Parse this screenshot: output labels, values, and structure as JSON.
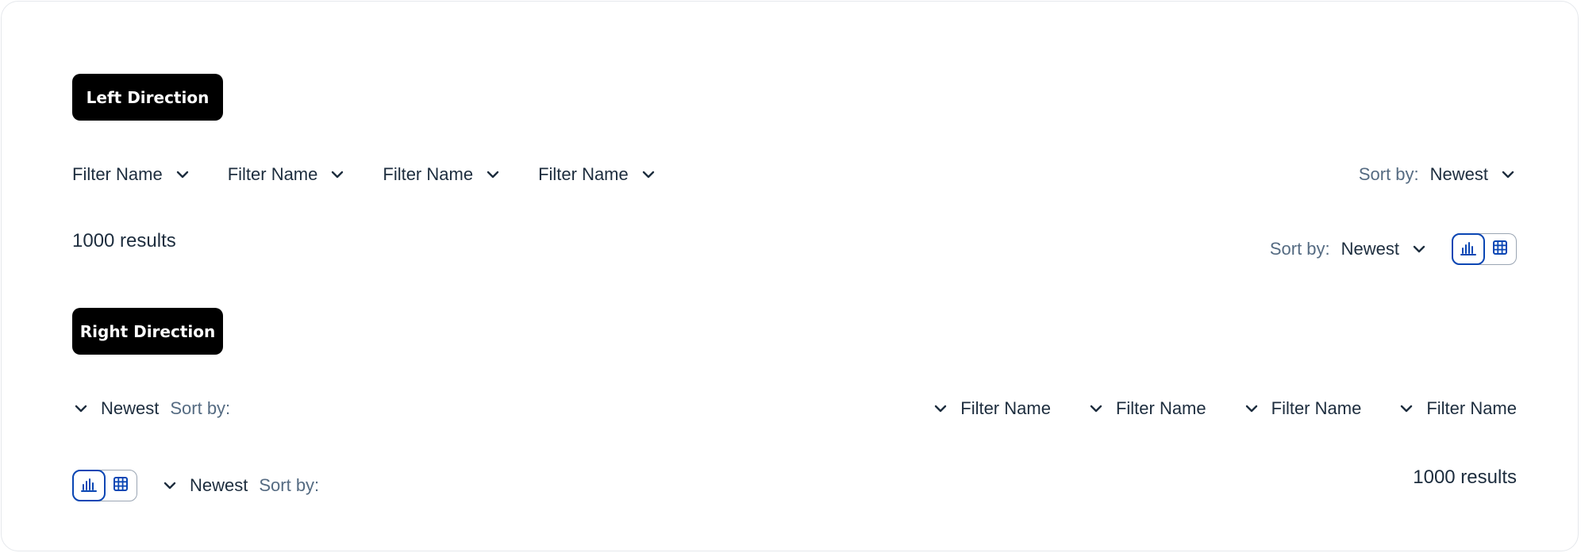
{
  "sections": {
    "left": {
      "tag_label": "Left Direction",
      "filters": [
        {
          "label": "Filter Name"
        },
        {
          "label": "Filter Name"
        },
        {
          "label": "Filter Name"
        },
        {
          "label": "Filter Name"
        }
      ],
      "sort": {
        "label": "Sort by:",
        "value": "Newest"
      },
      "results": "1000 results",
      "sort_secondary": {
        "label": "Sort by:",
        "value": "Newest"
      }
    },
    "right": {
      "tag_label": "Right Direction",
      "sort": {
        "label": "Sort by:",
        "value": "Newest"
      },
      "filters": [
        {
          "label": "Filter Name"
        },
        {
          "label": "Filter Name"
        },
        {
          "label": "Filter Name"
        },
        {
          "label": "Filter Name"
        }
      ],
      "sort_secondary": {
        "label": "Sort by:",
        "value": "Newest"
      },
      "results": "1000 results"
    }
  },
  "icons": {
    "chevron": "chevron-down-icon",
    "chart_view": "bar-chart-icon",
    "table_view": "grid-table-icon"
  },
  "colors": {
    "accent": "#0a46b4",
    "text": "#1d2d3e",
    "muted": "#556b82",
    "tag_bg": "#000000"
  }
}
